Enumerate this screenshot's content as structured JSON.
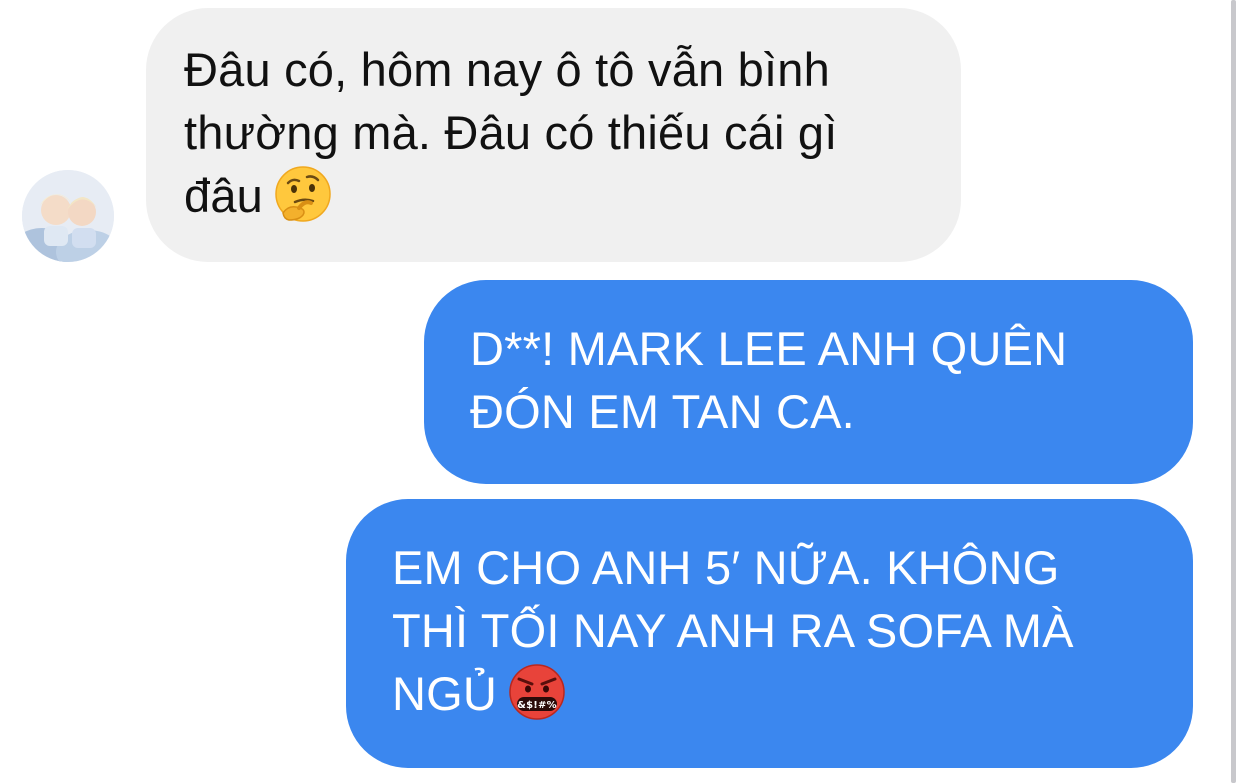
{
  "conversation": {
    "incoming": {
      "lines": [
        "Đâu có, hôm nay ô tô vẫn bình",
        "thường mà. Đâu có thiếu cái gì",
        "đâu"
      ],
      "emoji": "thinking-face"
    },
    "outgoing_1": {
      "lines": [
        "D**! MARK LEE ANH QUÊN",
        "ĐÓN EM TAN CA."
      ]
    },
    "outgoing_2": {
      "lines": [
        "EM CHO ANH 5′ NỮA. KHÔNG",
        "THÌ TỐI NAY ANH RA SOFA MÀ",
        "NGỦ"
      ],
      "emoji": "face-with-symbols-on-mouth"
    }
  },
  "colors": {
    "incoming_bubble": "#f0f0f0",
    "outgoing_bubble": "#3b87ef",
    "outgoing_text": "#ffffff",
    "incoming_text": "#111111"
  }
}
